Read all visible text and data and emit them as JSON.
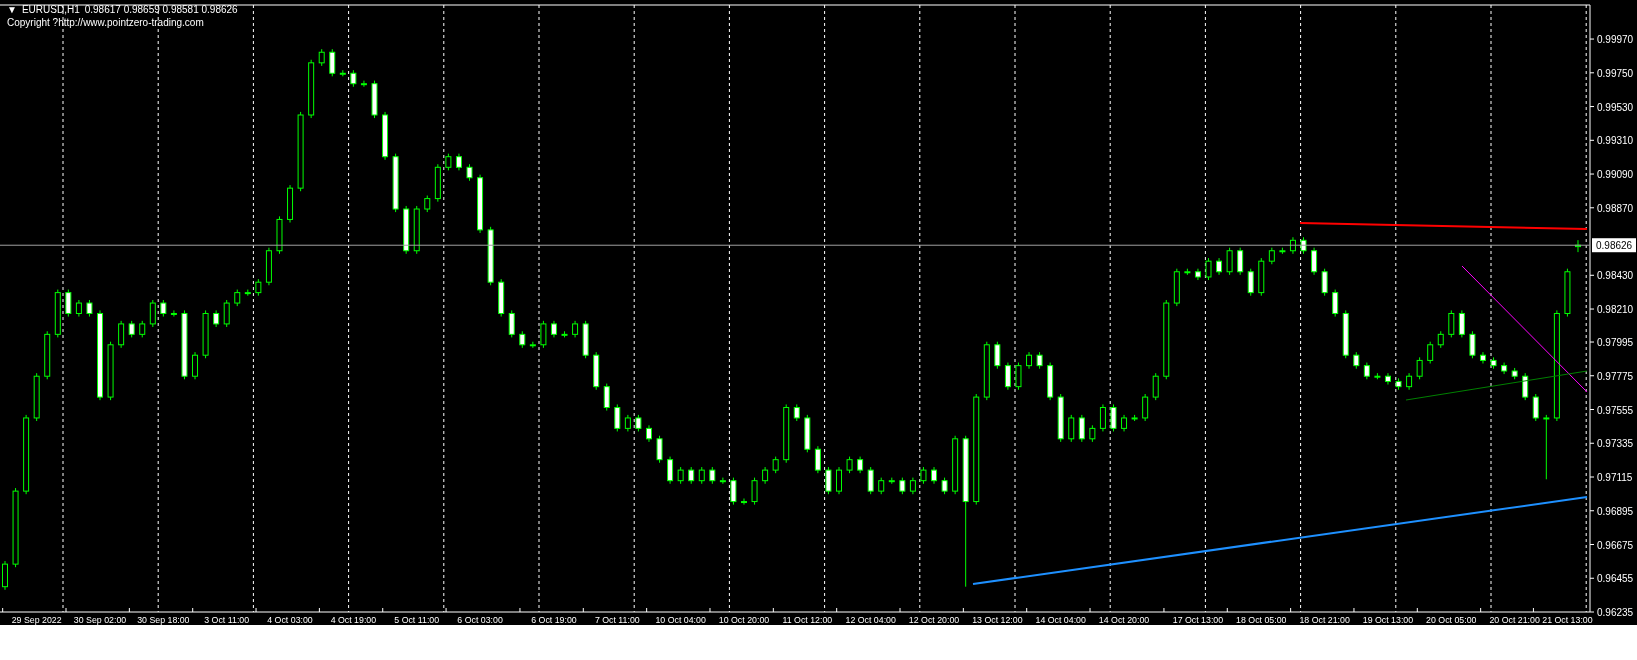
{
  "header": {
    "menu_glyph": "▼",
    "symbol": "EURUSD,H1",
    "ohlc": "0.98617 0.98659 0.98581 0.98626",
    "copyright": "Copyright ?http://www.pointzero-trading.com"
  },
  "chart_data": {
    "type": "candlestick",
    "categories": [
      null,
      null,
      null,
      "29 Sep 2022",
      null,
      null,
      null,
      null,
      null,
      "30 Sep 02:00",
      null,
      null,
      null,
      null,
      null,
      "30 Sep 18:00",
      null,
      null,
      null,
      null,
      null,
      "3 Oct 11:00",
      null,
      null,
      null,
      null,
      null,
      "4 Oct 03:00",
      null,
      null,
      null,
      null,
      null,
      "4 Oct 19:00",
      null,
      null,
      null,
      null,
      null,
      "5 Oct 11:00",
      null,
      null,
      null,
      null,
      null,
      "6 Oct 03:00",
      null,
      null,
      null,
      null,
      null,
      null,
      "6 Oct 19:00",
      null,
      null,
      null,
      null,
      null,
      "7 Oct 11:00",
      null,
      null,
      null,
      null,
      null,
      "10 Oct 04:00",
      null,
      null,
      null,
      null,
      null,
      "10 Oct 20:00",
      null,
      null,
      null,
      null,
      null,
      "11 Oct 12:00",
      null,
      null,
      null,
      null,
      null,
      "12 Oct 04:00",
      null,
      null,
      null,
      null,
      null,
      "12 Oct 20:00",
      null,
      null,
      null,
      null,
      null,
      "13 Oct 12:00",
      null,
      null,
      null,
      null,
      null,
      "14 Oct 04:00",
      null,
      null,
      null,
      null,
      null,
      "14 Oct 20:00",
      null,
      null,
      null,
      null,
      null,
      null,
      "17 Oct 13:00",
      null,
      null,
      null,
      null,
      null,
      "18 Oct 05:00",
      null,
      null,
      null,
      null,
      null,
      "18 Oct 21:00",
      null,
      null,
      null,
      null,
      null,
      "19 Oct 13:00",
      null,
      null,
      null,
      null,
      null,
      "20 Oct 05:00",
      null,
      null,
      null,
      null,
      null,
      "20 Oct 21:00",
      null,
      null,
      null,
      null,
      "21 Oct 13:00",
      null
    ],
    "ohlc": [
      [
        0.964,
        0.96567,
        0.9638,
        0.96547
      ],
      [
        0.96547,
        0.97043,
        0.96527,
        0.97023
      ],
      [
        0.97023,
        0.9752,
        0.97003,
        0.975
      ],
      [
        0.975,
        0.97792,
        0.9748,
        0.97772
      ],
      [
        0.97772,
        0.98065,
        0.97752,
        0.98045
      ],
      [
        0.98045,
        0.98337,
        0.98025,
        0.98317
      ],
      [
        0.98317,
        0.98337,
        0.98161,
        0.98181
      ],
      [
        0.98181,
        0.98269,
        0.98161,
        0.98249
      ],
      [
        0.98249,
        0.98269,
        0.98161,
        0.98181
      ],
      [
        0.98181,
        0.98201,
        0.97616,
        0.97636
      ],
      [
        0.97636,
        0.97997,
        0.97616,
        0.97977
      ],
      [
        0.97977,
        0.98133,
        0.97957,
        0.98113
      ],
      [
        0.98113,
        0.98133,
        0.98025,
        0.98045
      ],
      [
        0.98045,
        0.98133,
        0.98025,
        0.98113
      ],
      [
        0.98113,
        0.98269,
        0.98093,
        0.98249
      ],
      [
        0.98249,
        0.98269,
        0.98161,
        0.98181
      ],
      [
        0.98181,
        0.98201,
        0.98161,
        0.98181
      ],
      [
        0.98181,
        0.98201,
        0.97752,
        0.97772
      ],
      [
        0.97772,
        0.97929,
        0.97752,
        0.97909
      ],
      [
        0.97909,
        0.98201,
        0.97889,
        0.98181
      ],
      [
        0.98181,
        0.98201,
        0.98093,
        0.98113
      ],
      [
        0.98113,
        0.98269,
        0.98093,
        0.98249
      ],
      [
        0.98249,
        0.98337,
        0.98229,
        0.98317
      ],
      [
        0.98317,
        0.98337,
        0.98297,
        0.98317
      ],
      [
        0.98317,
        0.98405,
        0.98297,
        0.98385
      ],
      [
        0.98385,
        0.9861,
        0.98365,
        0.9859
      ],
      [
        0.9859,
        0.98814,
        0.9857,
        0.98794
      ],
      [
        0.98794,
        0.99018,
        0.98774,
        0.98998
      ],
      [
        0.98998,
        0.99495,
        0.98978,
        0.99475
      ],
      [
        0.99475,
        0.99835,
        0.99455,
        0.99815
      ],
      [
        0.99815,
        0.99904,
        0.99795,
        0.99884
      ],
      [
        0.99884,
        0.99904,
        0.99727,
        0.99747
      ],
      [
        0.99747,
        0.99767,
        0.99727,
        0.99747
      ],
      [
        0.99747,
        0.99767,
        0.99659,
        0.99679
      ],
      [
        0.99679,
        0.99699,
        0.99659,
        0.99679
      ],
      [
        0.99679,
        0.99699,
        0.99455,
        0.99475
      ],
      [
        0.99475,
        0.99495,
        0.99183,
        0.99203
      ],
      [
        0.99203,
        0.99223,
        0.98842,
        0.98862
      ],
      [
        0.98862,
        0.98882,
        0.9857,
        0.9859
      ],
      [
        0.9859,
        0.98882,
        0.9857,
        0.98862
      ],
      [
        0.98862,
        0.9895,
        0.98842,
        0.9893
      ],
      [
        0.9893,
        0.99154,
        0.9891,
        0.99134
      ],
      [
        0.99134,
        0.99223,
        0.99114,
        0.99203
      ],
      [
        0.99203,
        0.99223,
        0.99114,
        0.99134
      ],
      [
        0.99134,
        0.99154,
        0.99046,
        0.99066
      ],
      [
        0.99066,
        0.99086,
        0.98706,
        0.98726
      ],
      [
        0.98726,
        0.98746,
        0.98365,
        0.98385
      ],
      [
        0.98385,
        0.98405,
        0.98161,
        0.98181
      ],
      [
        0.98181,
        0.98201,
        0.98025,
        0.98045
      ],
      [
        0.98045,
        0.98065,
        0.97957,
        0.97977
      ],
      [
        0.97977,
        0.97997,
        0.97957,
        0.97977
      ],
      [
        0.97977,
        0.98133,
        0.97957,
        0.98113
      ],
      [
        0.98113,
        0.98133,
        0.98025,
        0.98045
      ],
      [
        0.98045,
        0.98065,
        0.98025,
        0.98045
      ],
      [
        0.98045,
        0.98133,
        0.98025,
        0.98113
      ],
      [
        0.98113,
        0.98133,
        0.97889,
        0.97909
      ],
      [
        0.97909,
        0.97929,
        0.97684,
        0.97704
      ],
      [
        0.97704,
        0.97724,
        0.97548,
        0.97568
      ],
      [
        0.97568,
        0.97588,
        0.97412,
        0.97432
      ],
      [
        0.97432,
        0.9752,
        0.97412,
        0.975
      ],
      [
        0.975,
        0.9752,
        0.97412,
        0.97432
      ],
      [
        0.97432,
        0.97452,
        0.97344,
        0.97364
      ],
      [
        0.97364,
        0.97384,
        0.97208,
        0.97228
      ],
      [
        0.97228,
        0.97248,
        0.97071,
        0.97091
      ],
      [
        0.97091,
        0.9718,
        0.97071,
        0.9716
      ],
      [
        0.9716,
        0.9718,
        0.97071,
        0.97091
      ],
      [
        0.97091,
        0.9718,
        0.97071,
        0.9716
      ],
      [
        0.9716,
        0.9718,
        0.97071,
        0.97091
      ],
      [
        0.97091,
        0.97111,
        0.97071,
        0.97091
      ],
      [
        0.97091,
        0.97111,
        0.96935,
        0.96955
      ],
      [
        0.96955,
        0.96975,
        0.96935,
        0.96955
      ],
      [
        0.96955,
        0.97111,
        0.96935,
        0.97091
      ],
      [
        0.97091,
        0.9718,
        0.97071,
        0.9716
      ],
      [
        0.9716,
        0.97248,
        0.9714,
        0.97228
      ],
      [
        0.97228,
        0.97588,
        0.97208,
        0.97568
      ],
      [
        0.97568,
        0.97588,
        0.9748,
        0.975
      ],
      [
        0.975,
        0.9752,
        0.97276,
        0.97296
      ],
      [
        0.97296,
        0.97316,
        0.9714,
        0.9716
      ],
      [
        0.9716,
        0.9718,
        0.97003,
        0.97023
      ],
      [
        0.97023,
        0.9718,
        0.97003,
        0.9716
      ],
      [
        0.9716,
        0.97248,
        0.9714,
        0.97228
      ],
      [
        0.97228,
        0.97248,
        0.9714,
        0.9716
      ],
      [
        0.9716,
        0.9718,
        0.97003,
        0.97023
      ],
      [
        0.97023,
        0.97111,
        0.97003,
        0.97091
      ],
      [
        0.97091,
        0.97111,
        0.97071,
        0.97091
      ],
      [
        0.97091,
        0.97111,
        0.97003,
        0.97023
      ],
      [
        0.97023,
        0.97111,
        0.97003,
        0.97091
      ],
      [
        0.97091,
        0.9718,
        0.97071,
        0.9716
      ],
      [
        0.9716,
        0.9718,
        0.97071,
        0.97091
      ],
      [
        0.97091,
        0.97111,
        0.97003,
        0.97023
      ],
      [
        0.97023,
        0.97384,
        0.97003,
        0.97364
      ],
      [
        0.97364,
        0.97384,
        0.964,
        0.96955
      ],
      [
        0.96955,
        0.97656,
        0.96935,
        0.97636
      ],
      [
        0.97636,
        0.97997,
        0.97616,
        0.97977
      ],
      [
        0.97977,
        0.97997,
        0.97821,
        0.97841
      ],
      [
        0.97841,
        0.97861,
        0.97684,
        0.97704
      ],
      [
        0.97704,
        0.97861,
        0.97684,
        0.97841
      ],
      [
        0.97841,
        0.97929,
        0.97821,
        0.97909
      ],
      [
        0.97909,
        0.97929,
        0.97821,
        0.97841
      ],
      [
        0.97841,
        0.97861,
        0.97616,
        0.97636
      ],
      [
        0.97636,
        0.97656,
        0.97344,
        0.97364
      ],
      [
        0.97364,
        0.9752,
        0.97344,
        0.975
      ],
      [
        0.975,
        0.9752,
        0.97344,
        0.97364
      ],
      [
        0.97364,
        0.97452,
        0.97344,
        0.97432
      ],
      [
        0.97432,
        0.97588,
        0.97412,
        0.97568
      ],
      [
        0.97568,
        0.97588,
        0.97412,
        0.97432
      ],
      [
        0.97432,
        0.9752,
        0.97412,
        0.975
      ],
      [
        0.975,
        0.9752,
        0.9748,
        0.975
      ],
      [
        0.975,
        0.97656,
        0.9748,
        0.97636
      ],
      [
        0.97636,
        0.97792,
        0.97616,
        0.97772
      ],
      [
        0.97772,
        0.98269,
        0.97752,
        0.98249
      ],
      [
        0.98249,
        0.98473,
        0.98229,
        0.98453
      ],
      [
        0.98453,
        0.98473,
        0.98433,
        0.98453
      ],
      [
        0.98453,
        0.98473,
        0.98399,
        0.98419
      ],
      [
        0.98419,
        0.98542,
        0.98399,
        0.98522
      ],
      [
        0.98522,
        0.98542,
        0.98433,
        0.98453
      ],
      [
        0.98453,
        0.9861,
        0.98433,
        0.9859
      ],
      [
        0.9859,
        0.9861,
        0.98433,
        0.98453
      ],
      [
        0.98453,
        0.98473,
        0.98297,
        0.98317
      ],
      [
        0.98317,
        0.98542,
        0.98297,
        0.98522
      ],
      [
        0.98522,
        0.9861,
        0.98502,
        0.9859
      ],
      [
        0.9859,
        0.9861,
        0.9857,
        0.9859
      ],
      [
        0.9859,
        0.98678,
        0.9857,
        0.98658
      ],
      [
        0.98658,
        0.98678,
        0.9857,
        0.9859
      ],
      [
        0.9859,
        0.9861,
        0.98433,
        0.98453
      ],
      [
        0.98453,
        0.98473,
        0.98297,
        0.98317
      ],
      [
        0.98317,
        0.98337,
        0.98161,
        0.98181
      ],
      [
        0.98181,
        0.98201,
        0.97889,
        0.97909
      ],
      [
        0.97909,
        0.97929,
        0.97821,
        0.97841
      ],
      [
        0.97841,
        0.97861,
        0.97752,
        0.97772
      ],
      [
        0.97772,
        0.97792,
        0.97752,
        0.97772
      ],
      [
        0.97772,
        0.97792,
        0.97718,
        0.97738
      ],
      [
        0.97738,
        0.97758,
        0.97684,
        0.97704
      ],
      [
        0.97704,
        0.97792,
        0.97684,
        0.97772
      ],
      [
        0.97772,
        0.97895,
        0.97752,
        0.97875
      ],
      [
        0.97875,
        0.97997,
        0.97855,
        0.97977
      ],
      [
        0.97977,
        0.98065,
        0.97957,
        0.98045
      ],
      [
        0.98045,
        0.98201,
        0.98025,
        0.98181
      ],
      [
        0.98181,
        0.98201,
        0.98025,
        0.98045
      ],
      [
        0.98045,
        0.98065,
        0.97889,
        0.97909
      ],
      [
        0.97909,
        0.97929,
        0.97855,
        0.97875
      ],
      [
        0.97875,
        0.97895,
        0.97821,
        0.97841
      ],
      [
        0.97841,
        0.97861,
        0.97786,
        0.97806
      ],
      [
        0.97806,
        0.97826,
        0.97752,
        0.97772
      ],
      [
        0.97772,
        0.97792,
        0.97616,
        0.97636
      ],
      [
        0.97636,
        0.97656,
        0.9748,
        0.975
      ],
      [
        0.975,
        0.9752,
        0.971,
        0.975
      ],
      [
        0.975,
        0.98201,
        0.9748,
        0.98181
      ],
      [
        0.98181,
        0.98473,
        0.98161,
        0.98453
      ],
      [
        0.98617,
        0.98659,
        0.98581,
        0.98626
      ]
    ],
    "ylim": [
      0.96235,
      1.00192
    ],
    "yticks": [
      {
        "value": 0.9997,
        "label": "0.99970"
      },
      {
        "value": 0.9975,
        "label": "0.99750"
      },
      {
        "value": 0.9953,
        "label": "0.99530"
      },
      {
        "value": 0.9931,
        "label": "0.99310"
      },
      {
        "value": 0.9909,
        "label": "0.99090"
      },
      {
        "value": 0.9887,
        "label": "0.98870"
      },
      {
        "value": 0.9843,
        "label": "0.98430"
      },
      {
        "value": 0.9821,
        "label": "0.98210"
      },
      {
        "value": 0.97995,
        "label": "0.97995"
      },
      {
        "value": 0.97775,
        "label": "0.97775"
      },
      {
        "value": 0.97555,
        "label": "0.97555"
      },
      {
        "value": 0.97335,
        "label": "0.97335"
      },
      {
        "value": 0.97115,
        "label": "0.97115"
      },
      {
        "value": 0.96895,
        "label": "0.96895"
      },
      {
        "value": 0.96675,
        "label": "0.96675"
      },
      {
        "value": 0.96455,
        "label": "0.96455"
      },
      {
        "value": 0.96235,
        "label": "0.96235"
      }
    ],
    "ref_lines": [
      {
        "axis": "y",
        "value": 0.98626,
        "label": "0.98626"
      }
    ]
  },
  "drawings": [
    {
      "kind": "trendline",
      "color": "#ff0000"
    },
    {
      "kind": "trendline",
      "color": "#ff00ff"
    },
    {
      "kind": "trendline",
      "color": "#008000"
    },
    {
      "kind": "trendline",
      "color": "#1e90ff"
    }
  ]
}
